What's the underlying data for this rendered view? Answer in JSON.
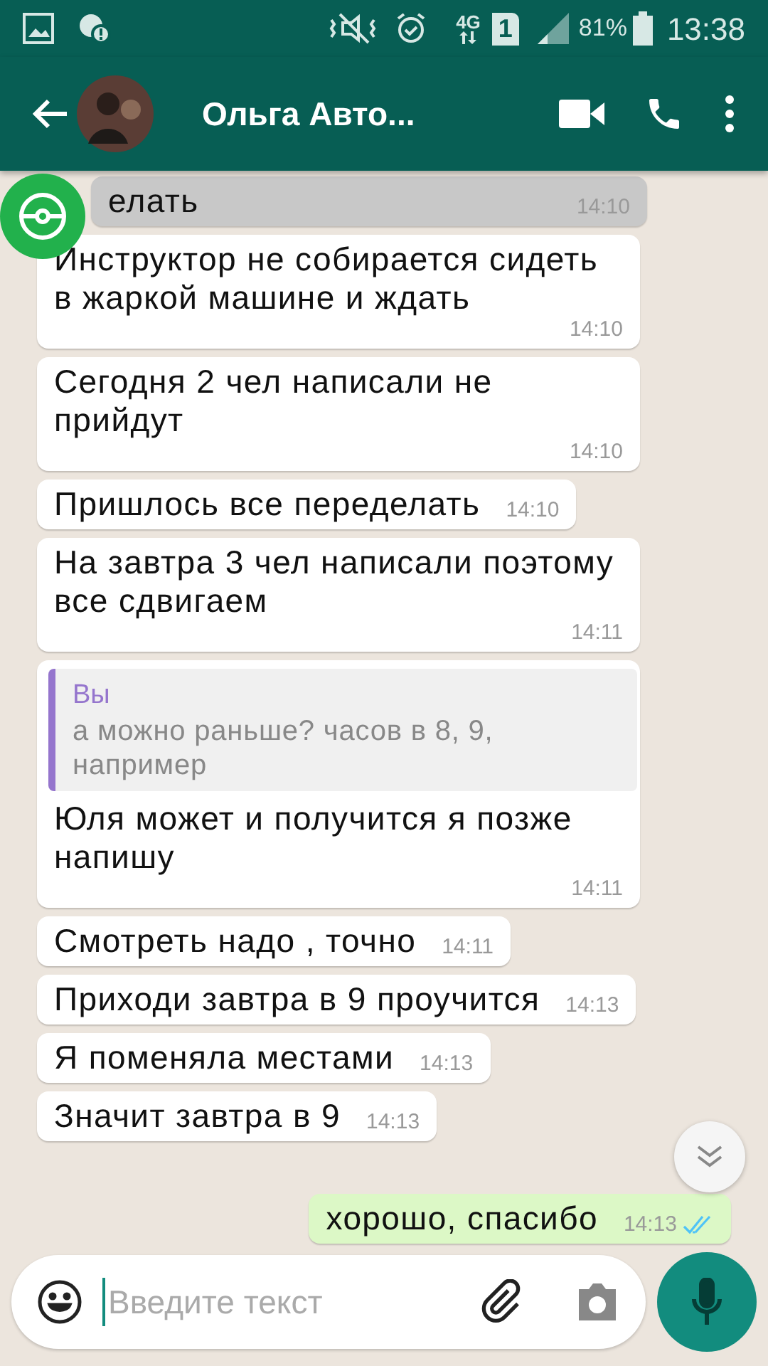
{
  "status_bar": {
    "network": "4G",
    "sim": "1",
    "battery": "81%",
    "time": "13:38"
  },
  "header": {
    "title": "Ольга Авто..."
  },
  "messages": [
    {
      "kind": "partial",
      "text": "елать",
      "time": "14:10",
      "selected": true
    },
    {
      "kind": "incoming",
      "text": "Инструктор не собирается сидеть в жаркой машине и ждать",
      "time": "14:10",
      "selected": false
    },
    {
      "kind": "incoming",
      "text": "Сегодня 2 чел написали не прийдут",
      "time": "14:10",
      "selected": false
    },
    {
      "kind": "incoming",
      "text": "Пришлось все переделать",
      "time": "14:10",
      "selected": false
    },
    {
      "kind": "incoming",
      "text": "На завтра 3 чел написали поэтому все сдвигаем",
      "time": "14:11",
      "selected": false
    },
    {
      "kind": "incoming",
      "text": "Юля может и получится я позже напишу",
      "time": "14:11",
      "selected": false,
      "quote": {
        "author": "Вы",
        "text": "а можно раньше? часов в 8, 9, например"
      }
    },
    {
      "kind": "incoming",
      "text": "Смотреть надо , точно",
      "time": "14:11",
      "selected": false
    },
    {
      "kind": "incoming",
      "text": "Приходи завтра в 9 проучится",
      "time": "14:13",
      "selected": false
    },
    {
      "kind": "incoming",
      "text": "Я поменяла местами",
      "time": "14:13",
      "selected": false
    },
    {
      "kind": "incoming",
      "text": "Значит завтра в 9",
      "time": "14:13",
      "selected": false
    },
    {
      "kind": "outgoing",
      "text": "хорошо, спасибо",
      "time": "14:13",
      "read": true
    }
  ],
  "composer": {
    "placeholder": "Введите текст"
  }
}
